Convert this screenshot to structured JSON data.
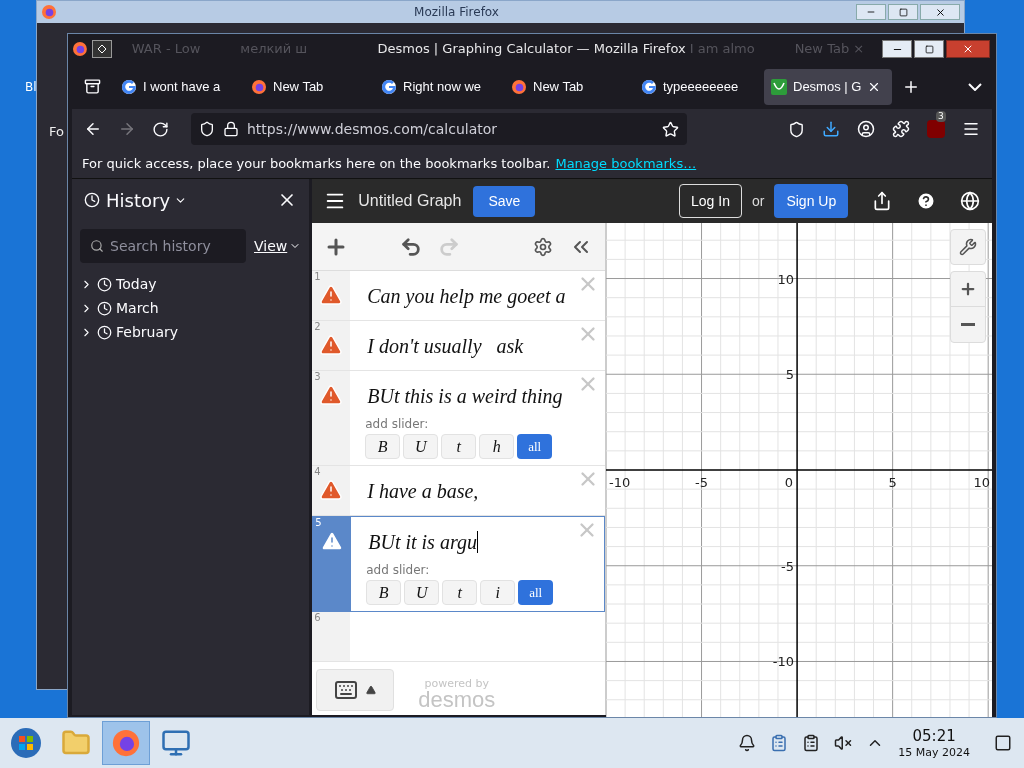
{
  "desktop": {
    "icon_label": "Bl"
  },
  "back_window": {
    "title": "Mozilla Firefox",
    "toolbar_text": "Fo"
  },
  "window": {
    "title": "Desmos | Graphing Calculator — Mozilla Firefox",
    "background_tabs_left": [
      "WAR - Low",
      "мелкий ш"
    ],
    "background_tabs_right": [
      "I am almo",
      "New Tab ×"
    ]
  },
  "tabs": [
    {
      "title": "I wont have a",
      "kind": "google",
      "selected": false
    },
    {
      "title": "New Tab",
      "kind": "firefox",
      "selected": false
    },
    {
      "title": "Right now we",
      "kind": "google",
      "selected": false
    },
    {
      "title": "New Tab",
      "kind": "firefox",
      "selected": false
    },
    {
      "title": "typeeeeeeee",
      "kind": "google",
      "selected": false
    },
    {
      "title": "Desmos | G",
      "kind": "desmos",
      "selected": true
    }
  ],
  "navbar": {
    "url": "https://www.desmos.com/calculator",
    "extension_badge": "3"
  },
  "bookmarks_bar": {
    "message": "For quick access, place your bookmarks here on the bookmarks toolbar.",
    "link": "Manage bookmarks…"
  },
  "sidebar": {
    "title": "History",
    "search_placeholder": "Search history",
    "view_button": "View",
    "items": [
      {
        "label": "Today",
        "expanded": false
      },
      {
        "label": "March",
        "expanded": false
      },
      {
        "label": "February",
        "expanded": false
      }
    ]
  },
  "desmos": {
    "graph_title": "Untitled Graph",
    "save": "Save",
    "login": "Log In",
    "or": "or",
    "signup": "Sign Up",
    "expressions": [
      {
        "number": "1",
        "text": "Can you help me goeet a",
        "warning": true,
        "selected": false
      },
      {
        "number": "2",
        "text": "I don't usually   ask",
        "warning": true,
        "selected": false
      },
      {
        "number": "3",
        "text": "BUt this is a weird thing",
        "warning": true,
        "selected": false,
        "slider_prompt": "add slider:",
        "sliders": [
          {
            "label": "B",
            "kind": "variable"
          },
          {
            "label": "U",
            "kind": "variable"
          },
          {
            "label": "t",
            "kind": "variable"
          },
          {
            "label": "h",
            "kind": "variable"
          },
          {
            "label": "all",
            "kind": "all"
          }
        ]
      },
      {
        "number": "4",
        "text": "I have a base,",
        "warning": true,
        "selected": false
      },
      {
        "number": "5",
        "text": "BUt it is argu",
        "warning": true,
        "selected": true,
        "slider_prompt": "add slider:",
        "sliders": [
          {
            "label": "B",
            "kind": "variable"
          },
          {
            "label": "U",
            "kind": "variable"
          },
          {
            "label": "t",
            "kind": "variable"
          },
          {
            "label": "i",
            "kind": "variable"
          },
          {
            "label": "all",
            "kind": "all"
          }
        ]
      },
      {
        "number": "6",
        "warning": false,
        "selected": false
      }
    ],
    "powered_by": "powered by",
    "brand": "desmos",
    "chart_data": {
      "type": "line",
      "grid": true,
      "xlim": [
        -10,
        10.2
      ],
      "ylim": [
        -12.9,
        12.9
      ],
      "xticks": [
        -10,
        -5,
        0,
        5,
        10
      ],
      "yticks": [
        -10,
        -5,
        5,
        10
      ]
    }
  },
  "taskbar": {
    "apps": [
      {
        "kind": "start",
        "active": false
      },
      {
        "kind": "folder",
        "active": false
      },
      {
        "kind": "firefox",
        "active": true
      },
      {
        "kind": "monitor",
        "active": false
      }
    ],
    "time": "05:21",
    "date": "15 May 2024"
  }
}
